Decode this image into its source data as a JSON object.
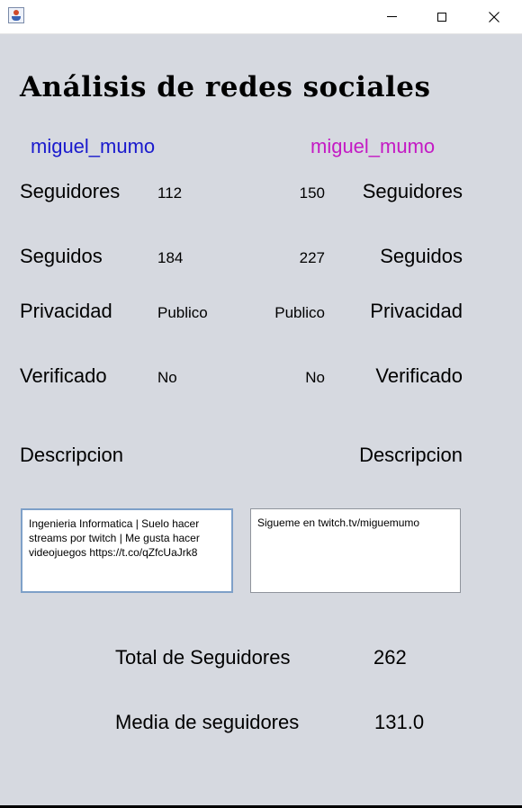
{
  "window": {
    "title": ""
  },
  "header": {
    "title": "Análisis de redes sociales"
  },
  "left": {
    "username": "miguel_mumo",
    "followers_label": "Seguidores",
    "followers": "112",
    "following_label": "Seguidos",
    "following": "184",
    "privacy_label": "Privacidad",
    "privacy": "Publico",
    "verified_label": "Verificado",
    "verified": "No",
    "description_label": "Descripcion",
    "description": "Ingenieria Informatica | Suelo hacer streams por twitch | Me gusta hacer videojuegos https://t.co/qZfcUaJrk8"
  },
  "right": {
    "username": "miguel_mumo",
    "followers_label": "Seguidores",
    "followers": "150",
    "following_label": "Seguidos",
    "following": "227",
    "privacy_label": "Privacidad",
    "privacy": "Publico",
    "verified_label": "Verificado",
    "verified": "No",
    "description_label": "Descripcion",
    "description": "Sigueme en twitch.tv/miguemumo"
  },
  "summary": {
    "total_label": "Total de Seguidores",
    "total": "262",
    "average_label": "Media de seguidores",
    "average": "131.0"
  },
  "colors": {
    "left_user": "#1a1acd",
    "right_user": "#c41ac4",
    "background": "#d6d9e0"
  },
  "icons": {
    "app": "java-app-icon",
    "minimize": "minimize-icon",
    "maximize": "maximize-icon",
    "close": "close-icon"
  }
}
